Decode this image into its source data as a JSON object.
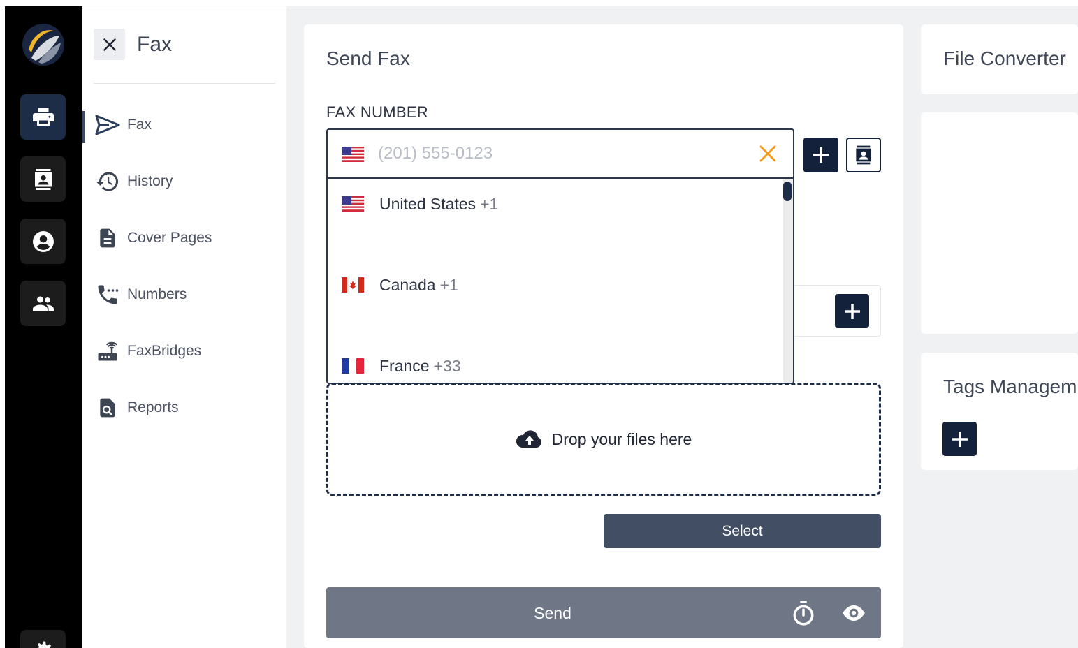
{
  "app": {
    "accent_color": "#14213a",
    "rail_active_color": "#1e2d47"
  },
  "rail": {
    "items": [
      {
        "name": "fax",
        "icon": "printer-icon",
        "active": true
      },
      {
        "name": "contacts",
        "icon": "contact-card-icon",
        "active": false
      },
      {
        "name": "account",
        "icon": "user-circle-icon",
        "active": false
      },
      {
        "name": "team",
        "icon": "group-icon",
        "active": false
      }
    ]
  },
  "subnav": {
    "title": "Fax",
    "items": [
      {
        "label": "Fax",
        "icon": "send-icon"
      },
      {
        "label": "History",
        "icon": "history-icon"
      },
      {
        "label": "Cover Pages",
        "icon": "document-icon"
      },
      {
        "label": "Numbers",
        "icon": "phone-dots-icon"
      },
      {
        "label": "FaxBridges",
        "icon": "router-icon"
      },
      {
        "label": "Reports",
        "icon": "report-search-icon"
      }
    ]
  },
  "send_fax": {
    "title": "Send Fax",
    "fax_number_label": "FAX NUMBER",
    "phone_placeholder": "(201) 555-0123",
    "phone_value": "",
    "countries": [
      {
        "name": "United States",
        "code": "+1"
      },
      {
        "name": "Canada",
        "code": "+1"
      },
      {
        "name": "France",
        "code": "+33"
      }
    ],
    "dropzone_text": "Drop your files here",
    "select_label": "Select",
    "send_label": "Send"
  },
  "right_panel": {
    "file_converter_title": "File Converter",
    "tags_title": "Tags Managem"
  }
}
